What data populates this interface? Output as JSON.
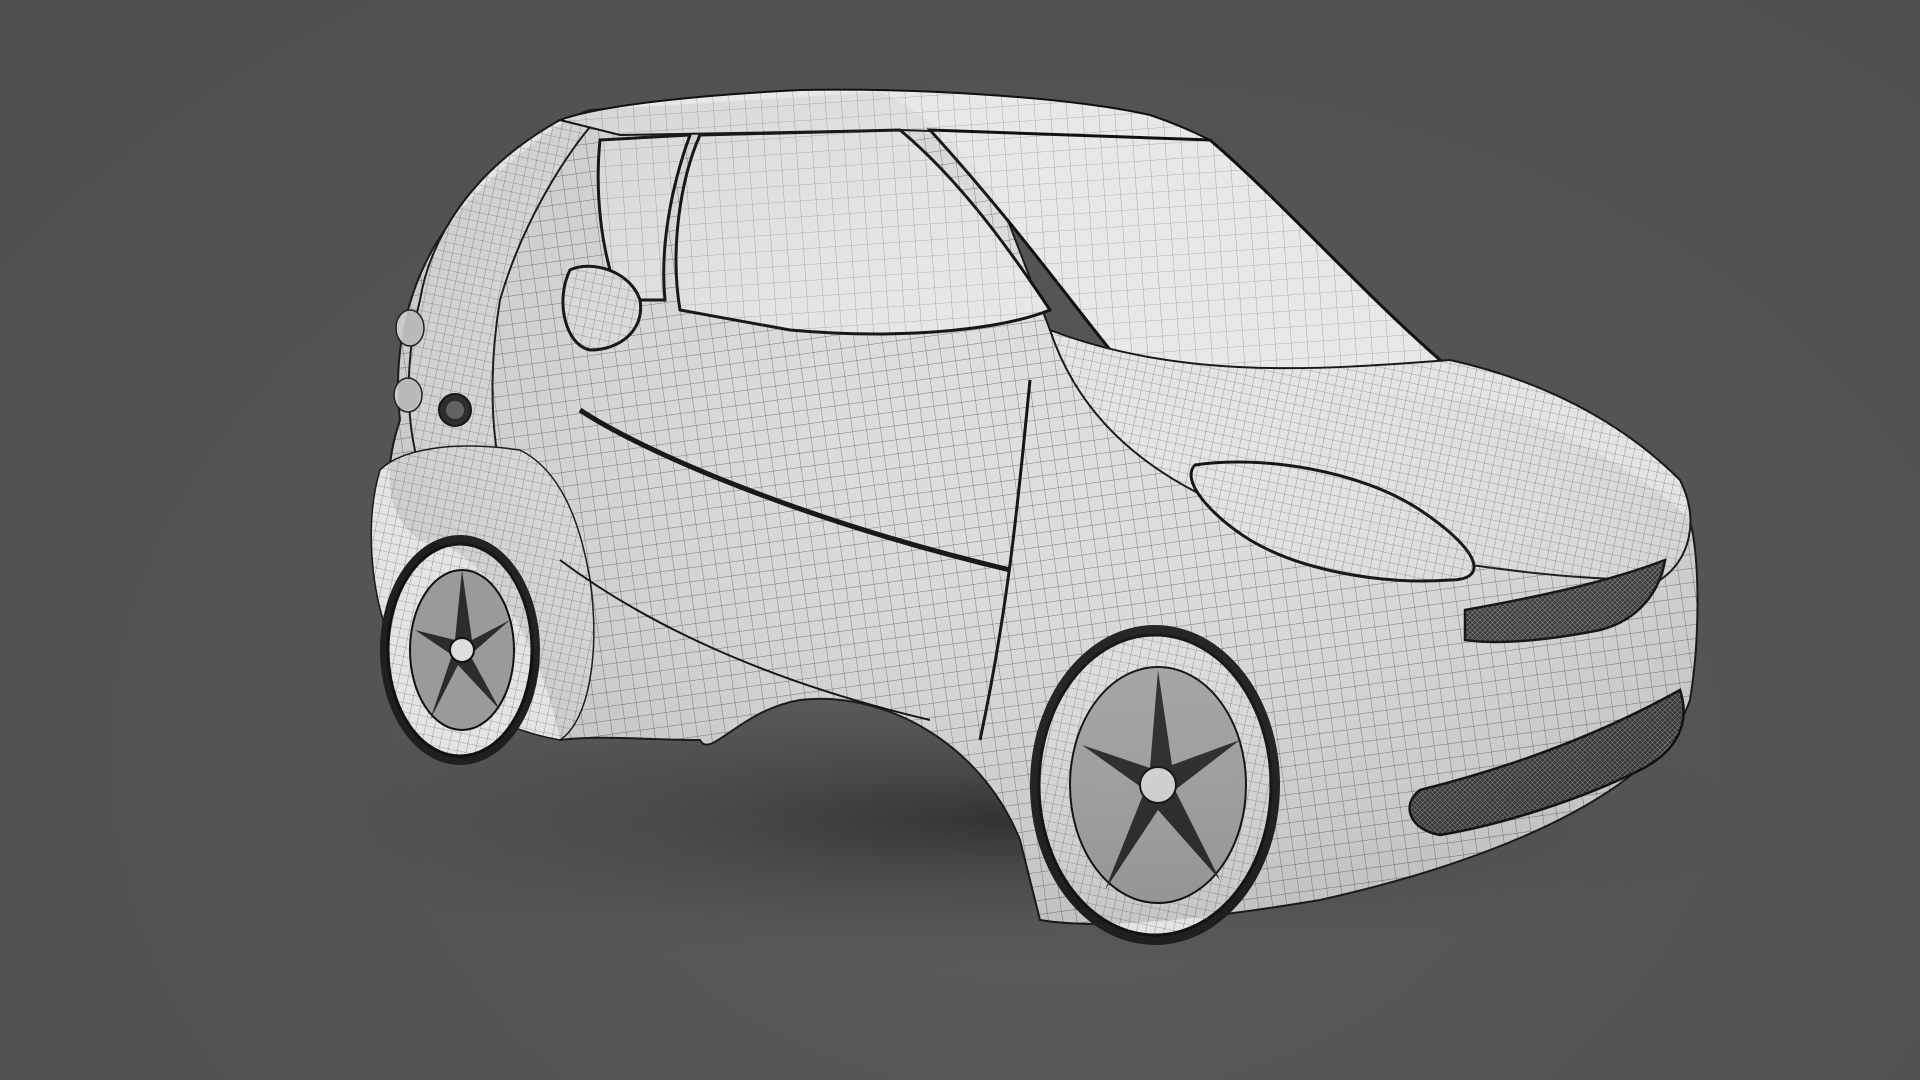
{
  "scene": {
    "subject": "car-wireframe-render",
    "background_color": "#555555",
    "body_color": "#dcdee0",
    "wire_color": "#2a2a2a",
    "shadow_color": "#3c3c3c"
  }
}
